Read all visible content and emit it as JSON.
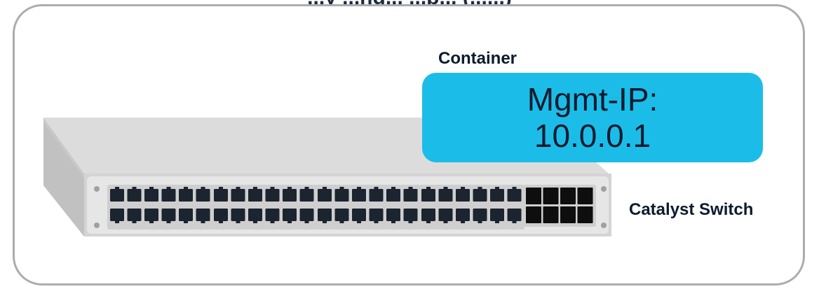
{
  "header": {
    "title": "...y ...ng... ...p... (......)"
  },
  "container": {
    "label": "Container",
    "mgmt_label": "Mgmt-IP:",
    "ip_address": "10.0.0.1",
    "color": "#1bbde8"
  },
  "switch": {
    "label": "Catalyst Switch",
    "port_groups": 4,
    "ports_per_group": 12,
    "uplink_ports": 8
  }
}
